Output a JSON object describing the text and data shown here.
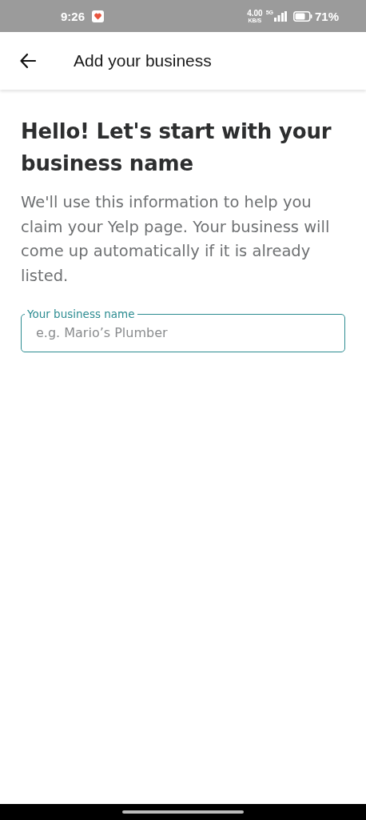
{
  "status_bar": {
    "time": "9:26",
    "speed": "4.00",
    "speed_unit": "KB/S",
    "network": "5G",
    "battery": "71%"
  },
  "app_bar": {
    "title": "Add your business"
  },
  "heading": "Hello! Let's start with your business name",
  "description": "We'll use this information to help you claim your Yelp page. Your business will come up automatically if it is already listed.",
  "field": {
    "label": "Your business name",
    "placeholder": "e.g. Mario’s Plumber"
  }
}
